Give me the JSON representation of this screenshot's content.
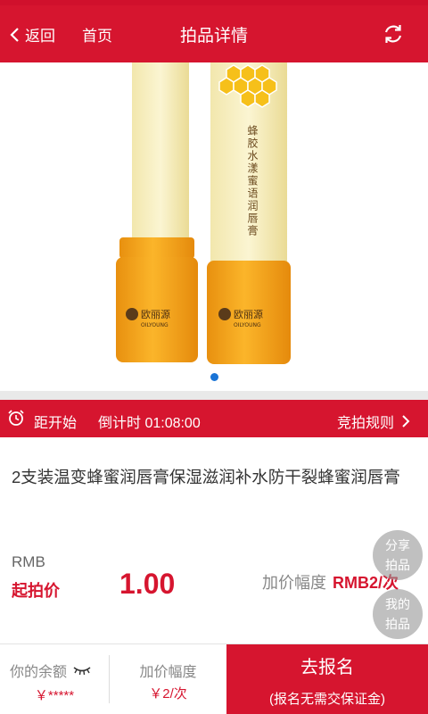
{
  "header": {
    "back_label": "返回",
    "home_label": "首页",
    "title": "拍品详情"
  },
  "gallery": {
    "brand_text": "欧丽源",
    "brand_sub": "OILYOUNG",
    "tube_text": "蜂胶水漾蜜语润唇膏",
    "active_dot": 0,
    "dot_count": 1
  },
  "countdown": {
    "label": "距开始",
    "timer": "倒计时 01:08:00",
    "rules_label": "竞拍规则"
  },
  "product": {
    "title": "2支装温变蜂蜜润唇膏保湿滋润补水防干裂蜂蜜润唇膏"
  },
  "price": {
    "currency": "RMB",
    "start_label": "起拍价",
    "start_value": "1.00",
    "increment_label": "加价幅度",
    "increment_value": "RMB2/次"
  },
  "floating": {
    "share_line1": "分享",
    "share_line2": "拍品",
    "mine_line1": "我的",
    "mine_line2": "拍品"
  },
  "bottom": {
    "balance_label": "你的余额",
    "balance_value": "￥*****",
    "increment_label": "加价幅度",
    "increment_value": "￥2/次",
    "signup_label": "去报名",
    "signup_sub": "(报名无需交保证金)"
  },
  "colors": {
    "brand_red": "#d6152f",
    "dot_blue": "#1a74d6",
    "tube_yellow": "#f5a21b"
  }
}
